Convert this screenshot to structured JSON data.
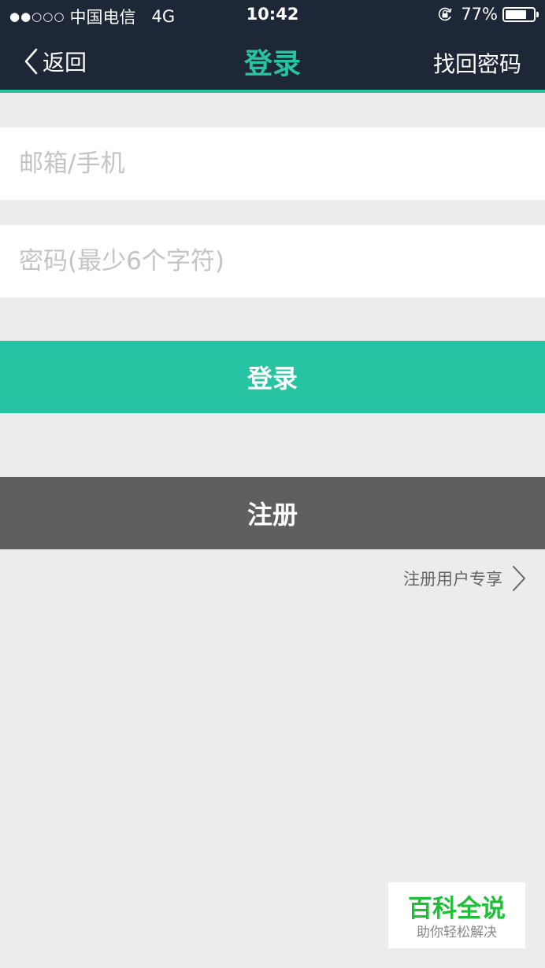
{
  "status_bar": {
    "signal": "●●○○○",
    "carrier": "中国电信",
    "network": "4G",
    "time": "10:42",
    "battery_percent_label": "77%",
    "battery_level": 0.77
  },
  "nav": {
    "back_label": "返回",
    "title": "登录",
    "right_label": "找回密码"
  },
  "form": {
    "account_placeholder": "邮箱/手机",
    "account_value": "",
    "password_placeholder": "密码(最少6个字符)",
    "password_value": ""
  },
  "buttons": {
    "login_label": "登录",
    "register_label": "注册"
  },
  "member_link": {
    "label": "注册用户专享"
  },
  "watermark": {
    "title": "百科全说",
    "subtitle": "助你轻松解决"
  },
  "colors": {
    "header_bg": "#1e2738",
    "accent": "#26c4a2",
    "page_bg": "#ececec",
    "register_bg": "#5f5f5f",
    "watermark_green": "#1dbf35"
  },
  "icons": {
    "back": "chevron-left-icon",
    "member": "chevron-right-icon",
    "lock": "orientation-lock-icon",
    "battery": "battery-icon"
  }
}
